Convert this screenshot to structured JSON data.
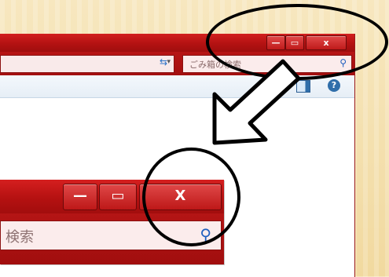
{
  "back_window": {
    "controls": {
      "minimize_glyph": "—",
      "maximize_glyph": "▭",
      "close_glyph": "x"
    },
    "address": {
      "dropdown_glyph": "▾",
      "refresh_icon": "refresh-icon"
    },
    "search": {
      "placeholder": "ごみ箱の検索",
      "icon": "search-icon"
    },
    "toolbar": {
      "preview_icon": "preview-pane-icon",
      "help_glyph": "?"
    }
  },
  "zoom_window": {
    "controls": {
      "minimize_glyph": "—",
      "maximize_glyph": "▭",
      "close_glyph": "X"
    },
    "search": {
      "visible_text": "検索",
      "icon": "search-icon"
    }
  },
  "annotations": {
    "circle_color": "#000000",
    "arrow_fill": "#ffffff",
    "arrow_stroke": "#000000"
  },
  "colors": {
    "titlebar_red": "#b31212",
    "search_bg": "#fbecec",
    "search_icon_blue": "#1f5fbf"
  }
}
